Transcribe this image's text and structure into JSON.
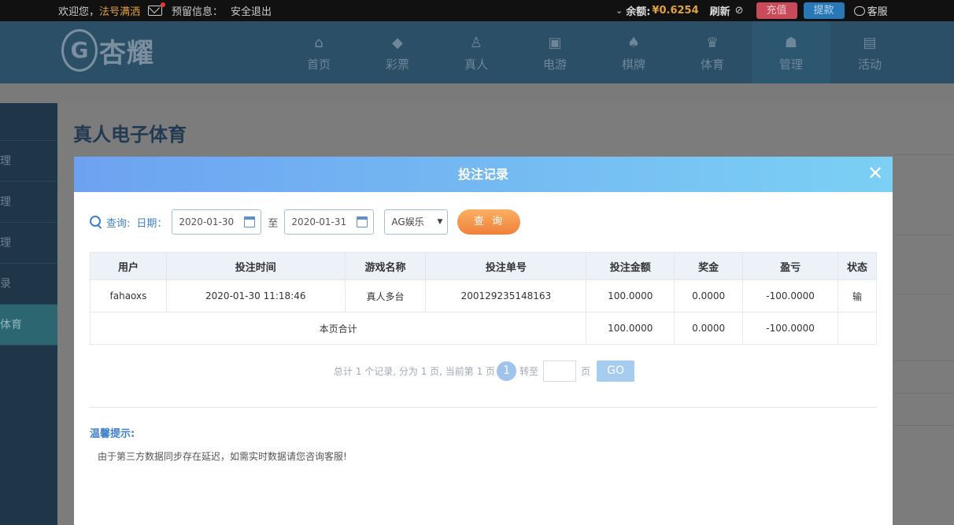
{
  "topbar": {
    "welcome": "欢迎您，",
    "username": "法号满洒",
    "reserved": "预留信息：",
    "logout": "安全退出",
    "balance_label": "余额:",
    "balance_value": "¥0.6254",
    "refresh": "刷新",
    "recharge": "充值",
    "withdraw": "提款",
    "service": "客服"
  },
  "logo": {
    "emblem": "G",
    "text": "杏耀"
  },
  "nav": [
    {
      "label": "首页",
      "icon": "home-icon"
    },
    {
      "label": "彩票",
      "icon": "lottery-icon"
    },
    {
      "label": "真人",
      "icon": "live-dealer-icon"
    },
    {
      "label": "电游",
      "icon": "slot-machine-icon"
    },
    {
      "label": "棋牌",
      "icon": "card-game-icon"
    },
    {
      "label": "体育",
      "icon": "trophy-icon"
    },
    {
      "label": "管理",
      "icon": "users-icon"
    },
    {
      "label": "活动",
      "icon": "gift-icon"
    }
  ],
  "sidebar": [
    "理",
    "理",
    "理",
    "录",
    "体育"
  ],
  "page_title": "真人电子体育",
  "modal": {
    "title": "投注记录",
    "query_label": "查询:",
    "date_label": "日期：",
    "date_from": "2020-01-30",
    "to_label": "至",
    "date_to": "2020-01-31",
    "platform": "AG娱乐",
    "query_button": "查 询",
    "columns": [
      "用户",
      "投注时间",
      "游戏名称",
      "投注单号",
      "投注金额",
      "奖金",
      "盈亏",
      "状态"
    ],
    "rows": [
      {
        "user": "fahaoxs",
        "time": "2020-01-30 11:18:46",
        "game": "真人多台",
        "order": "200129235148163",
        "amount": "100.0000",
        "bonus": "0.0000",
        "profit": "-100.0000",
        "status": "输"
      }
    ],
    "total": {
      "label": "本页合计",
      "amount": "100.0000",
      "bonus": "0.0000",
      "profit": "-100.0000"
    },
    "pager": {
      "summary": "总计 1 个记录, 分为 1 页, 当前第 1 页",
      "current": "1",
      "goto": "转至",
      "page": "页",
      "go": "GO"
    },
    "tip_title": "温馨提示:",
    "tip_text": "由于第三方数据同步存在延迟，如需实时数据请您咨询客服!"
  },
  "colors": {
    "accent": "#3f7fc8",
    "loss": "#cc2b2b",
    "query_button": "#f0803a"
  }
}
